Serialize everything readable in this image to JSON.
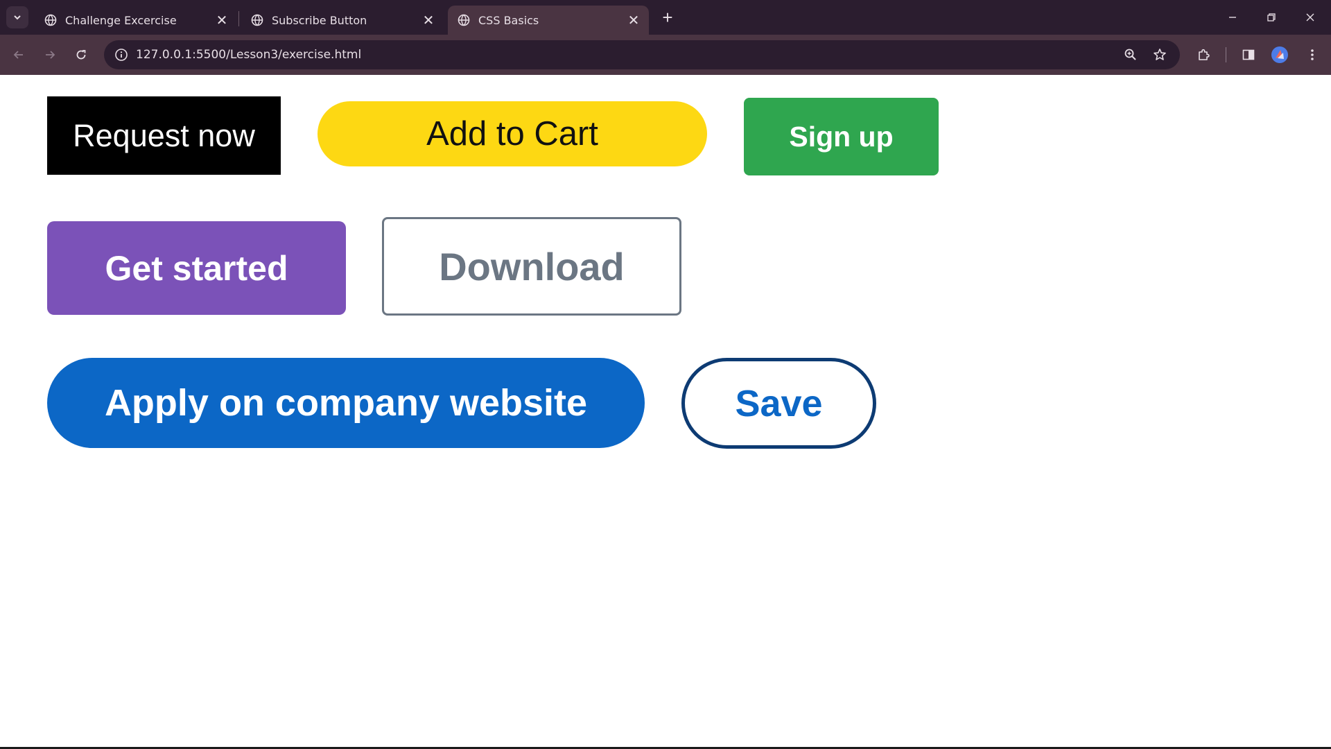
{
  "browser": {
    "tabs": [
      {
        "title": "Challenge Excercise",
        "active": false,
        "icon": "globe-icon"
      },
      {
        "title": "Subscribe Button",
        "active": false,
        "icon": "globe-icon"
      },
      {
        "title": "CSS Basics",
        "active": true,
        "icon": "globe-icon"
      }
    ],
    "url": "127.0.0.1:5500/Lesson3/exercise.html",
    "colors": {
      "frame": "#2b1d2f",
      "toolbar": "#4a3442",
      "omnibox": "#2b1d2f"
    }
  },
  "page": {
    "buttons": {
      "request_now": {
        "label": "Request now",
        "bg": "#000000",
        "fg": "#ffffff"
      },
      "add_to_cart": {
        "label": "Add to Cart",
        "bg": "#fdd813",
        "fg": "#111111"
      },
      "sign_up": {
        "label": "Sign up",
        "bg": "#2fa64f",
        "fg": "#ffffff"
      },
      "get_started": {
        "label": "Get started",
        "bg": "#7b52b8",
        "fg": "#ffffff"
      },
      "download": {
        "label": "Download",
        "bg": "#ffffff",
        "fg": "#6b7683",
        "border": "#6b7683"
      },
      "apply": {
        "label": "Apply on company website",
        "bg": "#0c67c6",
        "fg": "#ffffff"
      },
      "save": {
        "label": "Save",
        "bg": "#ffffff",
        "fg": "#0c67c6",
        "border": "#0d3b73"
      }
    }
  }
}
